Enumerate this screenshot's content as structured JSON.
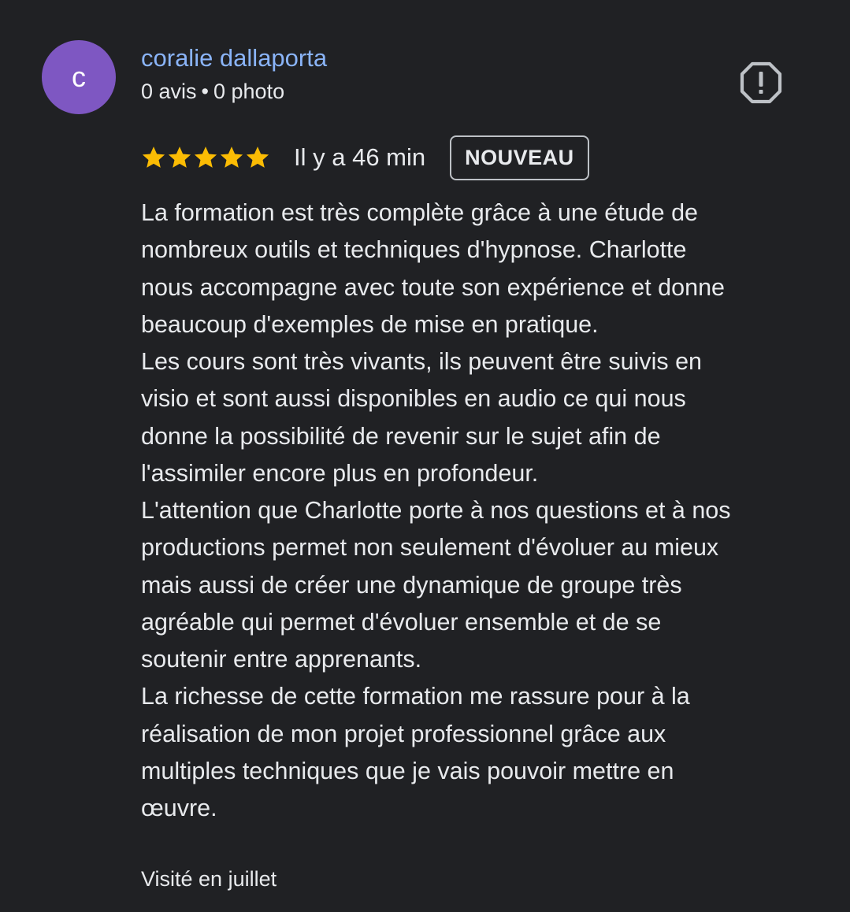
{
  "author": {
    "initial": "c",
    "name": "coralie dallaporta",
    "reviews_count": "0 avis",
    "separator": "•",
    "photos_count": "0 photo",
    "avatar_color": "#7e57c2",
    "name_color": "#8ab4f8"
  },
  "actions": {
    "report_icon": "report-flag-icon"
  },
  "rating": {
    "stars": 5,
    "max_stars": 5,
    "star_color": "#fbbc04",
    "time_ago": "Il y a 46 min",
    "badge": "NOUVEAU"
  },
  "review": {
    "lines": [
      "La formation est très complète grâce à une étude de",
      "nombreux outils et techniques d'hypnose. Charlotte",
      "nous accompagne avec toute son expérience et donne",
      "beaucoup d'exemples de mise en pratique.",
      "Les cours sont très vivants, ils peuvent être suivis en",
      "visio et sont aussi disponibles en audio ce qui nous",
      "donne la possibilité de revenir sur le sujet afin de",
      "l'assimiler encore plus en profondeur.",
      "L'attention que Charlotte porte à nos questions et à nos",
      "productions permet non seulement d'évoluer au mieux",
      "mais aussi de créer une dynamique de groupe très",
      "agréable qui permet d'évoluer ensemble et de se",
      "soutenir entre apprenants.",
      "La richesse de cette formation me rassure pour à la",
      "réalisation de mon projet professionnel grâce aux",
      "multiples techniques que je vais pouvoir mettre en",
      "œuvre."
    ]
  },
  "visit": {
    "label": "Visité en juillet"
  }
}
